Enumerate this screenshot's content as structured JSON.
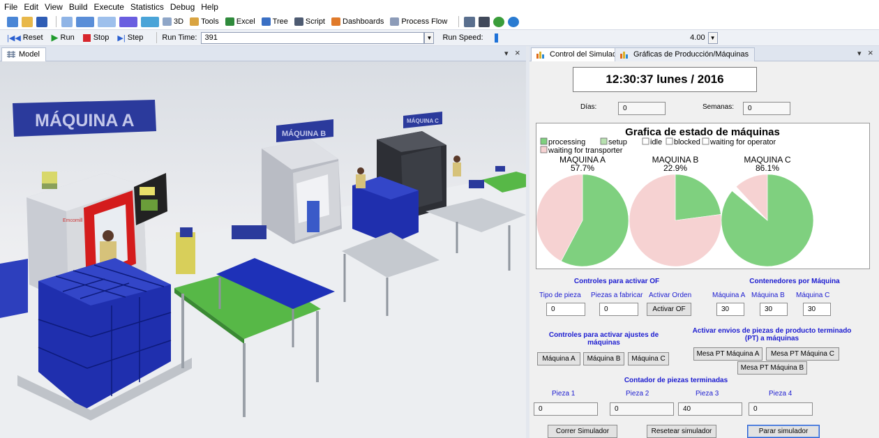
{
  "menu": [
    "File",
    "Edit",
    "View",
    "Build",
    "Execute",
    "Statistics",
    "Debug",
    "Help"
  ],
  "toolbar": {
    "items": [
      "3D",
      "Tools",
      "Excel",
      "Tree",
      "Script",
      "Dashboards",
      "Process Flow"
    ]
  },
  "runbar": {
    "reset": "Reset",
    "run": "Run",
    "stop": "Stop",
    "step": "Step",
    "run_time_label": "Run Time:",
    "run_time": "391",
    "run_speed_label": "Run Speed:",
    "run_speed": "4.00"
  },
  "left_tab": {
    "label": "Model",
    "pin": "▾",
    "close": "×"
  },
  "right_tabs": [
    {
      "label": "Control del Simulador"
    },
    {
      "label": "Gráficas de Producción/Máquinas"
    }
  ],
  "right_tab_ctrl": {
    "pin": "▾",
    "close": "×"
  },
  "model": {
    "signs": [
      "MÁQUINA A",
      "MÁQUINA B",
      "MÁQUINA C"
    ],
    "brand": "Emcomill"
  },
  "control": {
    "clock": "12:30:37 lunes / 2016",
    "dias_label": "Días:",
    "dias": "0",
    "semanas_label": "Semanas:",
    "semanas": "0",
    "chart_title": "Grafica de estado de máquinas",
    "legend": [
      "processing",
      "setup",
      "idle",
      "blocked",
      "waiting for operator",
      "waiting for transporter"
    ],
    "of_title": "Controles para activar OF",
    "of_labels": [
      "Tipo de pieza",
      "Piezas a fabricar",
      "Activar Orden"
    ],
    "tipo_pieza": "0",
    "piezas_fabricar": "0",
    "activar_of": "Activar OF",
    "cont_title": "Contenedores por Máquina",
    "cont_labels": [
      "Máquina A",
      "Máquina B",
      "Máquina C"
    ],
    "cont_values": [
      "30",
      "30",
      "30"
    ],
    "ajustes_title": "Controles para activar ajustes de máquinas",
    "ajustes_buttons": [
      "Máquina A",
      "Máquina B",
      "Máquina C"
    ],
    "envios_title": "Activar envios de piezas de producto terminado (PT) a máquinas",
    "envios_buttons": [
      "Mesa PT Máquina A",
      "Mesa PT Máquina C",
      "Mesa PT Máquina B"
    ],
    "contador_title": "Contador de piezas terminadas",
    "pieza_labels": [
      "Pieza 1",
      "Pieza 2",
      "Pieza 3",
      "Pieza 4"
    ],
    "pieza_values": [
      "0",
      "0",
      "40",
      "0"
    ],
    "bottom_buttons": [
      "Correr Simulador",
      "Resetear simulador",
      "Parar simulador"
    ]
  },
  "chart_data": {
    "type": "pie",
    "title": "Grafica de estado de máquinas",
    "legend": [
      "processing",
      "setup",
      "idle",
      "blocked",
      "waiting for operator",
      "waiting for transporter"
    ],
    "colors": {
      "processing": "#7fd07f",
      "setup": "#b8e0b0",
      "waiting for transporter": "#f6d2d2",
      "idle": "#ffffff",
      "blocked": "#ffffff",
      "waiting for operator": "#ffffff"
    },
    "charts": [
      {
        "name": "MAQUINA A",
        "label": "57.7%",
        "slices": [
          {
            "state": "processing",
            "value": 57.7
          },
          {
            "state": "waiting for transporter",
            "value": 42.3
          }
        ]
      },
      {
        "name": "MAQUINA B",
        "label": "22.9%",
        "slices": [
          {
            "state": "processing",
            "value": 22.9
          },
          {
            "state": "waiting for transporter",
            "value": 77.1
          }
        ]
      },
      {
        "name": "MAQUINA C",
        "label": "86.1%",
        "slices": [
          {
            "state": "processing",
            "value": 86.1
          },
          {
            "state": "idle",
            "value": 2.0
          },
          {
            "state": "waiting for transporter",
            "value": 11.9
          }
        ]
      }
    ]
  }
}
